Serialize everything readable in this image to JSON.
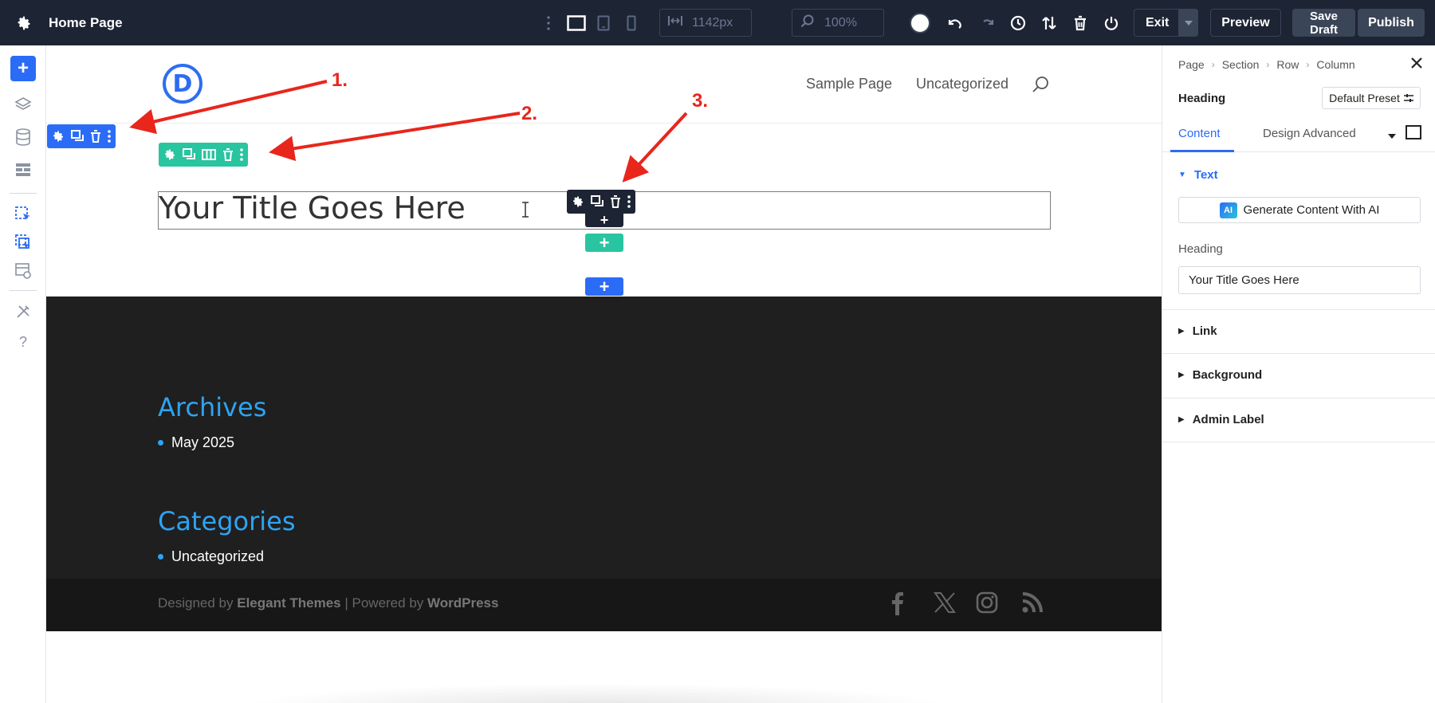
{
  "topbar": {
    "page_title": "Home Page",
    "width_value": "1142px",
    "zoom_value": "100%",
    "exit_label": "Exit",
    "preview_label": "Preview",
    "save_draft_line1": "Save",
    "save_draft_line2": "Draft",
    "publish_label": "Publish"
  },
  "site": {
    "logo_letter": "D",
    "nav": [
      "Sample Page",
      "Uncategorized"
    ],
    "heading_text": "Your Title Goes Here",
    "footer": {
      "archives_title": "Archives",
      "archives_item": "May 2025",
      "categories_title": "Categories",
      "categories_item": "Uncategorized",
      "credit_prefix": "Designed by",
      "credit_brand": "Elegant Themes",
      "credit_mid": "| Powered by",
      "credit_cms": "WordPress"
    }
  },
  "annotations": [
    "1.",
    "2.",
    "3."
  ],
  "panel": {
    "breadcrumbs": [
      "Page",
      "Section",
      "Row",
      "Column"
    ],
    "module_name": "Heading",
    "preset_label": "Default Preset",
    "tabs": [
      "Content",
      "Design",
      "Advanced"
    ],
    "text_section": "Text",
    "ai_button": "Generate Content With AI",
    "ai_badge": "AI",
    "heading_field_label": "Heading",
    "heading_field_value": "Your Title Goes Here",
    "collapsed_sections": [
      "Link",
      "Background",
      "Admin Label"
    ]
  },
  "colors": {
    "section_blue": "#2b6cf6",
    "row_green": "#29c4a0",
    "module_dark": "#1d2434",
    "annotation_red": "#e8261c",
    "footer_heading": "#2ea3f2"
  }
}
